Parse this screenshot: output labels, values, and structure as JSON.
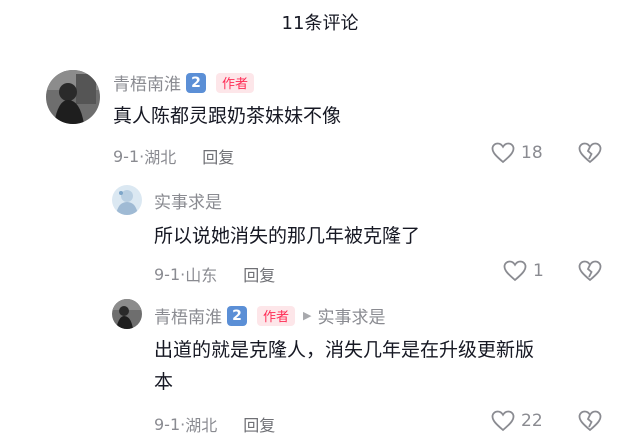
{
  "header": {
    "title": "11条评论"
  },
  "comments": [
    {
      "user": "青梧南淮",
      "level": "2",
      "author_tag": "作者",
      "text": "真人陈都灵跟奶茶妹妹不像",
      "date": "9-1",
      "location": "湖北",
      "reply_label": "回复",
      "likes": "18"
    },
    {
      "user": "实事求是",
      "text": "所以说她消失的那几年被克隆了",
      "date": "9-1",
      "location": "山东",
      "reply_label": "回复",
      "likes": "1"
    },
    {
      "user": "青梧南淮",
      "level": "2",
      "author_tag": "作者",
      "reply_to": "实事求是",
      "text_line1": "出道的就是克隆人，消失几年是在升级更新版",
      "text_line2": "本",
      "date": "9-1",
      "location": "湖北",
      "reply_label": "回复",
      "likes": "22"
    }
  ],
  "colors": {
    "accent": "#fe2c55",
    "level_badge": "#5b8fd6",
    "secondary_text": "#8a8b91"
  }
}
